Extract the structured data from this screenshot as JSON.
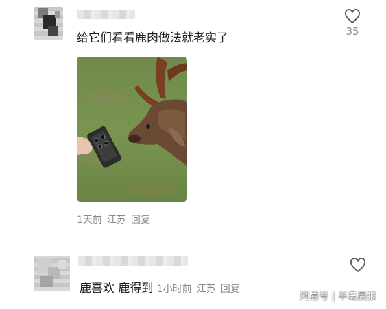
{
  "comments": [
    {
      "text": "给它们看看鹿肉做法就老实了",
      "like_count": "35",
      "meta": {
        "time": "1天前",
        "location": "江苏",
        "reply_label": "回复"
      }
    },
    {
      "text": "鹿喜欢 鹿得到",
      "meta": {
        "time": "1小时前",
        "location": "江苏",
        "reply_label": "回复"
      }
    }
  ],
  "watermark": "网易号 | 半岛晨报",
  "icons": {
    "like": "heart-outline-icon"
  },
  "colors": {
    "meta_text": "#8a8a8a",
    "body_text": "#1f1f1f"
  }
}
